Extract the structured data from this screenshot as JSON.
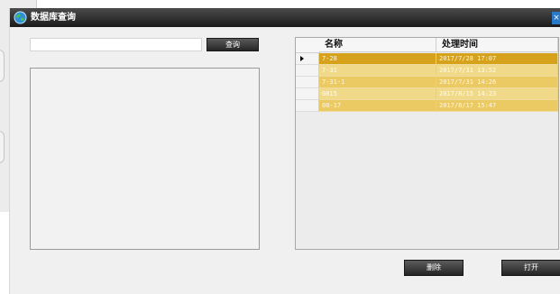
{
  "window": {
    "title": "数据库查询",
    "close_glyph": "×"
  },
  "search": {
    "value": "",
    "placeholder": "",
    "button_label": "查询"
  },
  "table": {
    "columns": [
      "名称",
      "处理时间"
    ],
    "rows": [
      {
        "name": "7-28",
        "time": "2017/7/28 17:07",
        "selected": true
      },
      {
        "name": "7-31",
        "time": "2017/7/31 13:52"
      },
      {
        "name": "7-31-1",
        "time": "2017/7/31 14:26"
      },
      {
        "name": "0815",
        "time": "2017/8/15 14:23"
      },
      {
        "name": "08-17",
        "time": "2017/8/17 15:47"
      }
    ]
  },
  "actions": {
    "delete_label": "删除",
    "open_label": "打开"
  },
  "colors": {
    "row_selected": "#d6a21c",
    "row_normal": "#ecca63",
    "row_alt": "#f1d98a",
    "titlebar": "#1b1b1b"
  },
  "icons": {
    "app": "globe-icon",
    "row_current": "triangle-right-icon"
  }
}
